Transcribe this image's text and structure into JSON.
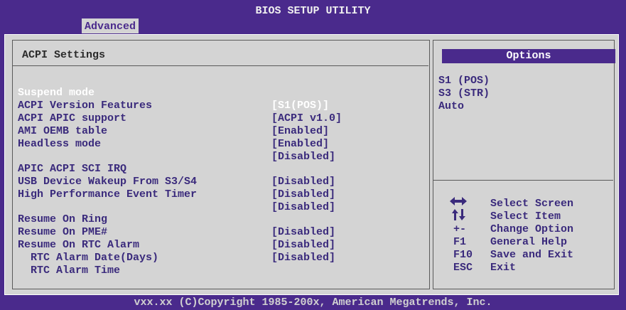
{
  "title": "BIOS SETUP UTILITY",
  "tab": "Advanced",
  "section_heading": "ACPI Settings",
  "settings": [
    {
      "label": "Suspend mode",
      "value": "[S1(POS)]",
      "selected": true
    },
    {
      "label": "ACPI Version Features",
      "value": "[ACPI v1.0]"
    },
    {
      "label": "ACPI APIC support",
      "value": "[Enabled]"
    },
    {
      "label": "AMI OEMB table",
      "value": "[Enabled]"
    },
    {
      "label": "Headless mode",
      "value": "[Disabled]"
    },
    {
      "label": "APIC ACPI SCI IRQ",
      "value": "[Disabled]"
    },
    {
      "label": "USB Device Wakeup From S3/S4",
      "value": "[Disabled]"
    },
    {
      "label": "High Performance Event Timer",
      "value": "[Disabled]"
    },
    {
      "label": "Resume On Ring",
      "value": "[Disabled]"
    },
    {
      "label": "Resume On PME#",
      "value": "[Disabled]"
    },
    {
      "label": "Resume On RTC Alarm",
      "value": "[Disabled]"
    },
    {
      "label": "RTC Alarm Date(Days)",
      "value": ""
    },
    {
      "label": "RTC Alarm Time",
      "value": ""
    }
  ],
  "options": {
    "header": "Options",
    "items": [
      "S1 (POS)",
      "S3 (STR)",
      "Auto"
    ]
  },
  "help": [
    {
      "key": "",
      "icon": "left-right-arrows-icon",
      "text": "Select Screen"
    },
    {
      "key": "",
      "icon": "up-down-arrows-icon",
      "text": "Select Item"
    },
    {
      "key": "+-",
      "text": "Change Option"
    },
    {
      "key": "F1",
      "text": "General Help"
    },
    {
      "key": "F10",
      "text": "Save and Exit"
    },
    {
      "key": "ESC",
      "text": "Exit"
    }
  ],
  "footer": "vxx.xx (C)Copyright 1985-200x, American Megatrends, Inc.",
  "colors": {
    "background": "#4a2a8c",
    "panel": "#d4d4d4",
    "text": "#3a2a7c",
    "selected_text": "#ffffff"
  }
}
